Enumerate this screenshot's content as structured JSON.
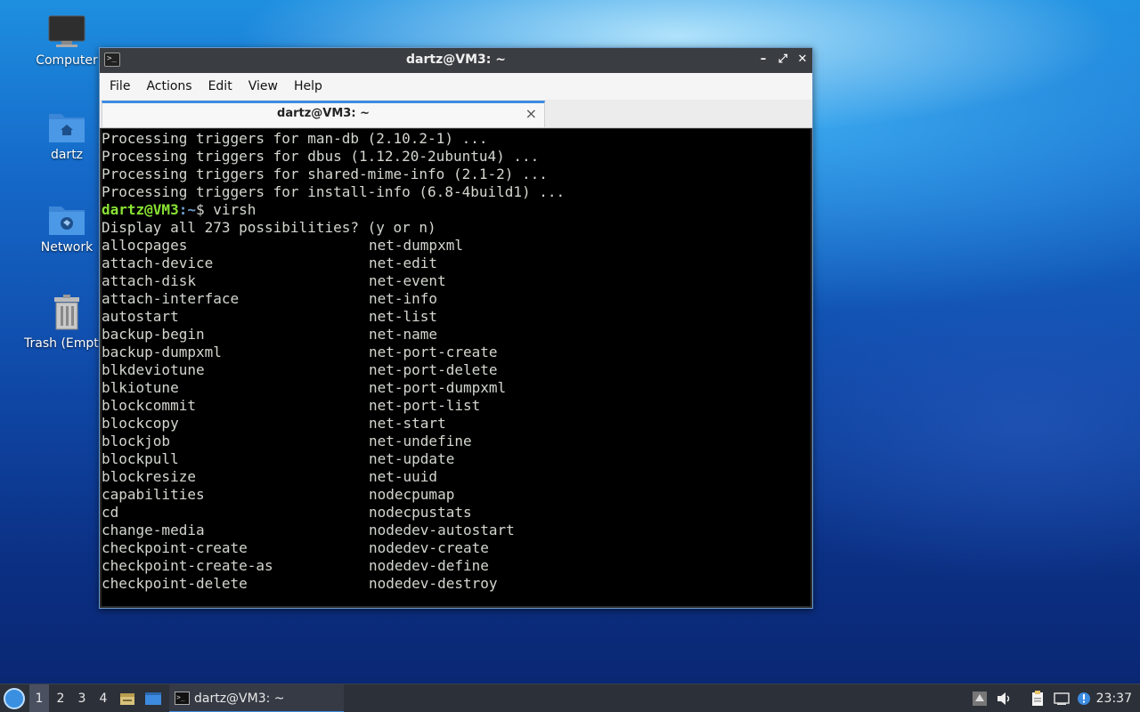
{
  "desktop": {
    "icons": [
      {
        "label": "Computer"
      },
      {
        "label": "dartz"
      },
      {
        "label": "Network"
      },
      {
        "label": "Trash (Empty)"
      }
    ]
  },
  "window": {
    "title": "dartz@VM3: ~",
    "menu": [
      "File",
      "Actions",
      "Edit",
      "View",
      "Help"
    ],
    "tab_title": "dartz@VM3: ~",
    "tab_close": "×",
    "controls": {
      "minimize": "–",
      "maximize": "⤢",
      "close": "✕"
    }
  },
  "terminal": {
    "lines_before": [
      "Processing triggers for man-db (2.10.2-1) ...",
      "Processing triggers for dbus (1.12.20-2ubuntu4) ...",
      "Processing triggers for shared-mime-info (2.1-2) ...",
      "Processing triggers for install-info (6.8-4build1) ..."
    ],
    "prompt": {
      "user_host": "dartz@VM3",
      "sep": ":",
      "path": "~",
      "symbol": "$",
      "command": " virsh"
    },
    "display_line": "Display all 273 possibilities? (y or n)",
    "completions": [
      [
        "allocpages",
        "net-dumpxml"
      ],
      [
        "attach-device",
        "net-edit"
      ],
      [
        "attach-disk",
        "net-event"
      ],
      [
        "attach-interface",
        "net-info"
      ],
      [
        "autostart",
        "net-list"
      ],
      [
        "backup-begin",
        "net-name"
      ],
      [
        "backup-dumpxml",
        "net-port-create"
      ],
      [
        "blkdeviotune",
        "net-port-delete"
      ],
      [
        "blkiotune",
        "net-port-dumpxml"
      ],
      [
        "blockcommit",
        "net-port-list"
      ],
      [
        "blockcopy",
        "net-start"
      ],
      [
        "blockjob",
        "net-undefine"
      ],
      [
        "blockpull",
        "net-update"
      ],
      [
        "blockresize",
        "net-uuid"
      ],
      [
        "capabilities",
        "nodecpumap"
      ],
      [
        "cd",
        "nodecpustats"
      ],
      [
        "change-media",
        "nodedev-autostart"
      ],
      [
        "checkpoint-create",
        "nodedev-create"
      ],
      [
        "checkpoint-create-as",
        "nodedev-define"
      ],
      [
        "checkpoint-delete",
        "nodedev-destroy"
      ]
    ]
  },
  "taskbar": {
    "workspaces": [
      "1",
      "2",
      "3",
      "4"
    ],
    "active_workspace": "1",
    "task_label": "dartz@VM3: ~",
    "clock": "23:37"
  },
  "colors": {
    "prompt_user": "#8ae234",
    "prompt_path": "#729fcf",
    "accent": "#3d8be0"
  }
}
